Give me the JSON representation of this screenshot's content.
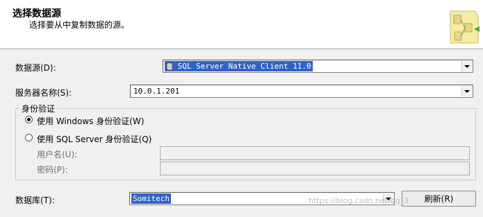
{
  "header": {
    "title": "选择数据源",
    "subtitle": "选择要从中复制数据的源。"
  },
  "form": {
    "datasource_label": "数据源(D):",
    "datasource_value": "SQL Server Native Client 11.0",
    "server_label": "服务器名称(S):",
    "server_value": "10.0.1.201",
    "auth_group_label": "身份验证",
    "auth_windows_label": "使用 Windows 身份验证(W)",
    "auth_sql_label": "使用 SQL Server 身份验证(Q)",
    "auth_selected": "windows",
    "username_label": "用户名(U):",
    "username_value": "",
    "password_label": "密码(P):",
    "password_value": "",
    "database_label": "数据库(T):",
    "database_value": "Somitech",
    "refresh_label": "刷新(R)"
  },
  "watermark": "https://blog.csdn.net/qq_3"
}
